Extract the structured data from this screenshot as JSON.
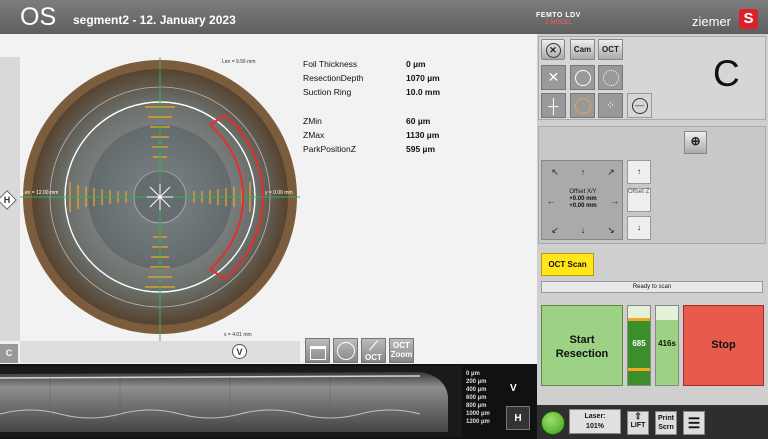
{
  "header": {
    "eye": "OS",
    "segment": "segment2  -  12. January 2023",
    "brand_line1": "FEMTO LDV",
    "brand_line2": "Z-MODEL",
    "brand_name": "ziemer",
    "logo_letter": "S"
  },
  "image_labels": {
    "top": "Len = 9.56 mm",
    "left": "Len = 12.00 mm",
    "right": "y = 0.00 mm",
    "bottom": "x = 4.01 mm"
  },
  "parameters": [
    {
      "label": "Foil Thickness",
      "value": "0 µm"
    },
    {
      "label": "ResectionDepth",
      "value": "1070 µm"
    },
    {
      "label": "Suction Ring",
      "value": "10.0 mm"
    },
    {
      "label": "ZMin",
      "value": "60 µm"
    },
    {
      "label": "ZMax",
      "value": "1130 µm"
    },
    {
      "label": "ParkPositionZ",
      "value": "595 µm"
    }
  ],
  "left_controls": {
    "h": "H",
    "c": "C",
    "v": "V"
  },
  "icon_buttons": {
    "oct": "OCT",
    "oct_zoom_1": "OCT",
    "oct_zoom_2": "Zoom"
  },
  "oct_scan_panel": {
    "depth_labels": [
      "0 µm",
      "200 µm",
      "400 µm",
      "600 µm",
      "800 µm",
      "1000 µm",
      "1200 µm"
    ],
    "v_label": "V",
    "h_label": "H"
  },
  "right_panel": {
    "cam": "Cam",
    "oct": "OCT",
    "mode_letter": "C",
    "offset_xy": "Offset X/Y",
    "offset_x": "+0.00 mm",
    "offset_y": "+0.00 mm",
    "offset_z": "Offset Z",
    "oct_scan_button": "OCT Scan",
    "status": "Ready to scan",
    "start_line1": "Start",
    "start_line2": "Resection",
    "bar1_value": "685",
    "bar2_value": "416s",
    "stop": "Stop",
    "laser_label": "Laser:",
    "laser_value": "101%",
    "lift": "LIFT",
    "print_1": "Print",
    "print_2": "Scrn"
  },
  "colors": {
    "accent_yellow": "#ffe51a",
    "start_green": "#9dd183",
    "stop_red": "#e85a4b",
    "progress_green": "#3a8f2a",
    "overlay_orange": "#f5a623",
    "overlay_red": "#e52e2e",
    "overlay_green": "#2fb54a"
  }
}
